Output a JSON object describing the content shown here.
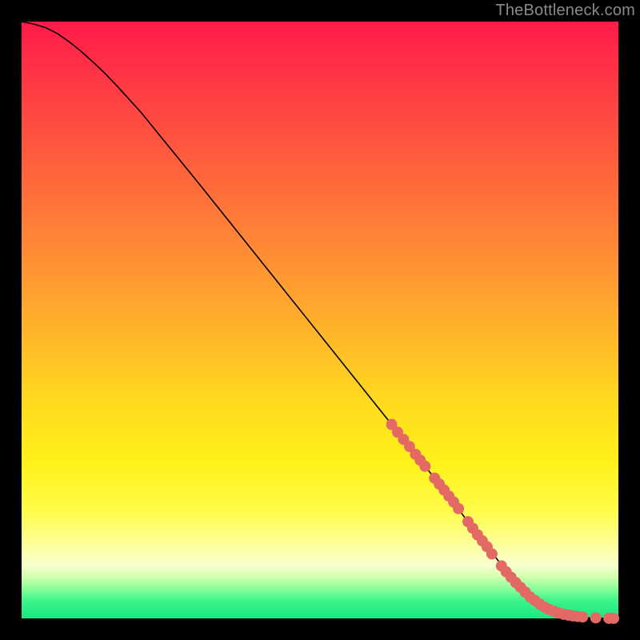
{
  "attribution": "TheBottleneck.com",
  "chart_data": {
    "type": "line",
    "title": "",
    "xlabel": "",
    "ylabel": "",
    "xlim": [
      0,
      100
    ],
    "ylim": [
      0,
      100
    ],
    "series": [
      {
        "name": "curve",
        "x": [
          0,
          2,
          4,
          6,
          8,
          10,
          12,
          14,
          16,
          20,
          30,
          40,
          50,
          60,
          70,
          78,
          80,
          82,
          84,
          86,
          88,
          90,
          92,
          94,
          96,
          98,
          100
        ],
        "y": [
          100,
          99.6,
          99.0,
          98.0,
          96.6,
          95.0,
          93.2,
          91.3,
          89.2,
          84.8,
          72.5,
          60.0,
          47.5,
          35.0,
          22.5,
          12.0,
          9.5,
          7.0,
          5.0,
          3.2,
          1.8,
          0.9,
          0.4,
          0.15,
          0.05,
          0.01,
          0.0
        ]
      }
    ],
    "markers": [
      {
        "x": 62.0,
        "y": 32.5
      },
      {
        "x": 63.0,
        "y": 31.2
      },
      {
        "x": 64.0,
        "y": 30.0
      },
      {
        "x": 65.0,
        "y": 28.8
      },
      {
        "x": 66.0,
        "y": 27.5
      },
      {
        "x": 66.8,
        "y": 26.5
      },
      {
        "x": 67.6,
        "y": 25.5
      },
      {
        "x": 69.2,
        "y": 23.5
      },
      {
        "x": 70.0,
        "y": 22.5
      },
      {
        "x": 70.8,
        "y": 21.5
      },
      {
        "x": 71.6,
        "y": 20.5
      },
      {
        "x": 72.4,
        "y": 19.5
      },
      {
        "x": 73.2,
        "y": 18.4
      },
      {
        "x": 74.8,
        "y": 16.2
      },
      {
        "x": 75.6,
        "y": 15.1
      },
      {
        "x": 76.4,
        "y": 14.0
      },
      {
        "x": 77.2,
        "y": 13.0
      },
      {
        "x": 78.0,
        "y": 12.0
      },
      {
        "x": 78.8,
        "y": 10.8
      },
      {
        "x": 80.4,
        "y": 8.8
      },
      {
        "x": 81.2,
        "y": 7.8
      },
      {
        "x": 82.0,
        "y": 6.9
      },
      {
        "x": 82.8,
        "y": 6.0
      },
      {
        "x": 83.6,
        "y": 5.2
      },
      {
        "x": 84.4,
        "y": 4.4
      },
      {
        "x": 85.2,
        "y": 3.6
      },
      {
        "x": 86.0,
        "y": 3.0
      },
      {
        "x": 86.8,
        "y": 2.4
      },
      {
        "x": 87.6,
        "y": 1.9
      },
      {
        "x": 88.4,
        "y": 1.5
      },
      {
        "x": 89.2,
        "y": 1.2
      },
      {
        "x": 90.0,
        "y": 0.9
      },
      {
        "x": 90.8,
        "y": 0.7
      },
      {
        "x": 91.6,
        "y": 0.55
      },
      {
        "x": 92.4,
        "y": 0.42
      },
      {
        "x": 93.2,
        "y": 0.32
      },
      {
        "x": 94.0,
        "y": 0.25
      },
      {
        "x": 96.2,
        "y": 0.1
      },
      {
        "x": 98.4,
        "y": 0.02
      },
      {
        "x": 99.2,
        "y": 0.01
      }
    ],
    "colors": {
      "line": "#000000",
      "marker_fill": "#e36a64",
      "marker_stroke": "#bf4f49",
      "gradient_top": "#ff1a49",
      "gradient_bottom": "#1de680"
    }
  }
}
